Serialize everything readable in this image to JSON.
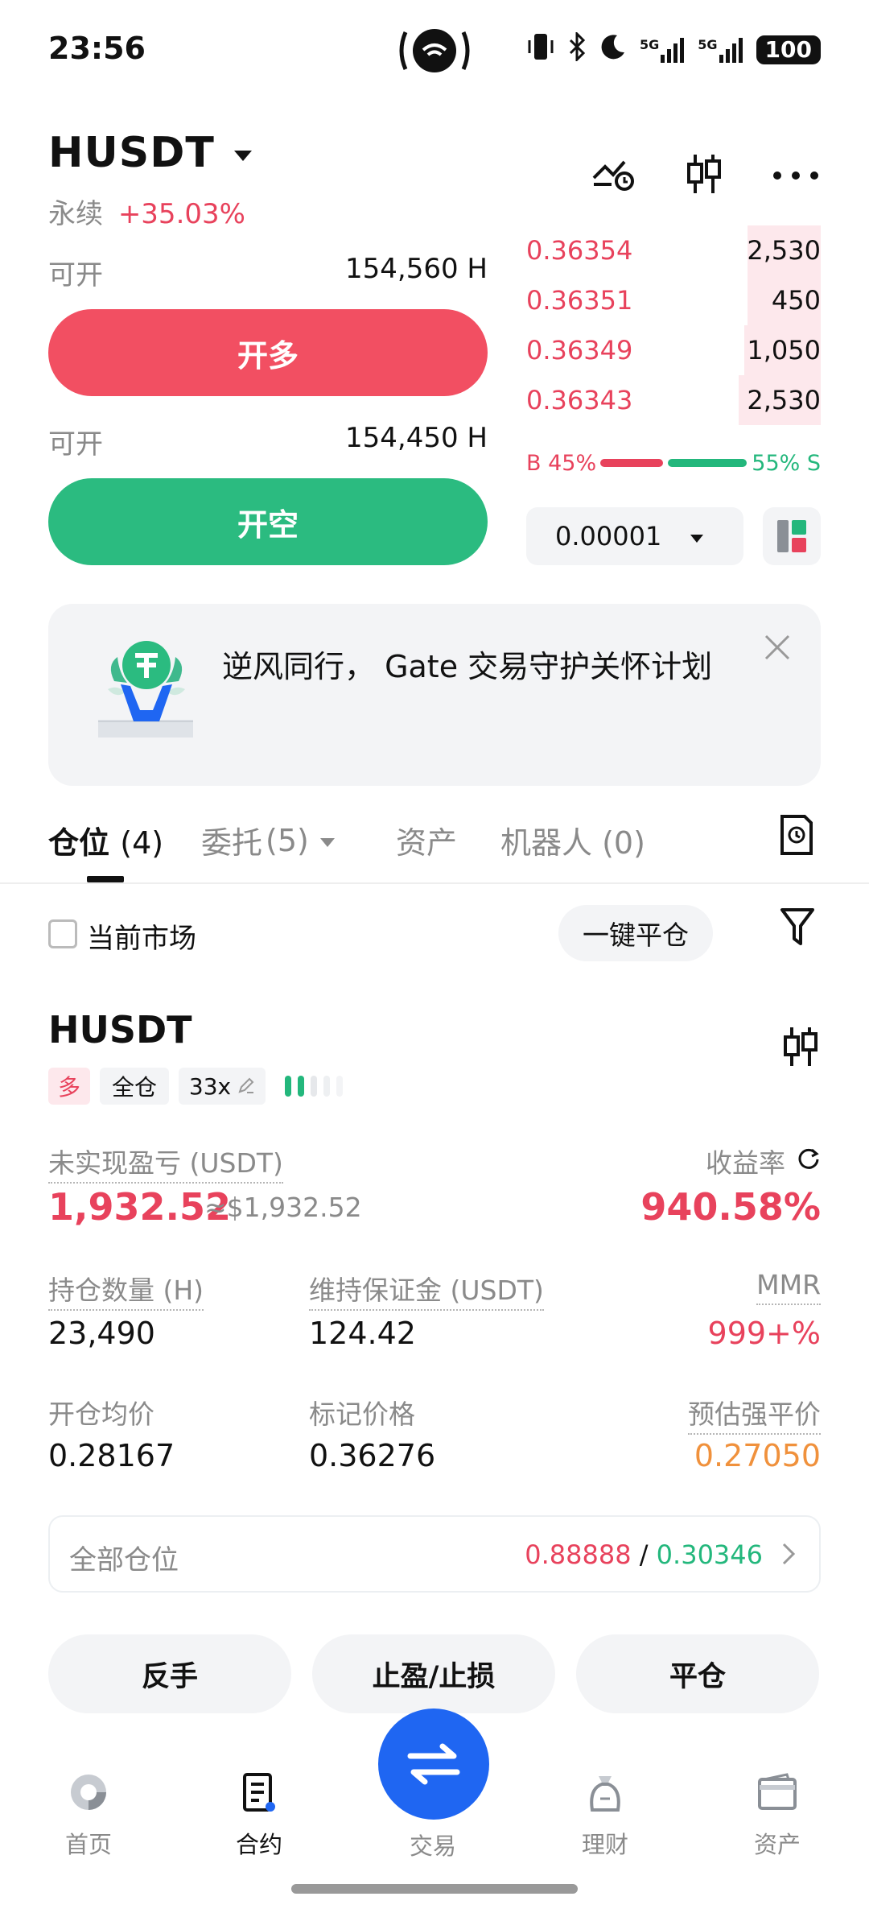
{
  "status": {
    "time": "23:56",
    "net1": "5G",
    "net2": "5G",
    "battery": "100"
  },
  "header": {
    "symbol": "HUSDT",
    "contract_type": "永续",
    "change": "+35.03%"
  },
  "order_panel": {
    "long_avail_label": "可开",
    "long_avail_value": "154,560 H",
    "long_button": "开多",
    "short_avail_label": "可开",
    "short_avail_value": "154,450 H",
    "short_button": "开空"
  },
  "orderbook": {
    "asks": [
      {
        "price": "0.36354",
        "qty": "2,530",
        "depth": 0.25
      },
      {
        "price": "0.36351",
        "qty": "450",
        "depth": 0.25
      },
      {
        "price": "0.36349",
        "qty": "1,050",
        "depth": 0.26
      },
      {
        "price": "0.36343",
        "qty": "2,530",
        "depth": 0.28
      }
    ],
    "buy_label": "B 45%",
    "sell_label": "55% S",
    "buy_ratio": 0.45,
    "precision": "0.00001"
  },
  "banner": {
    "text": "逆风同行， Gate 交易守护关怀计划"
  },
  "tabs": {
    "positions": "仓位",
    "positions_count": "(4)",
    "orders": "委托",
    "orders_count": "(5)",
    "assets": "资产",
    "bots": "机器人",
    "bots_count": "(0)"
  },
  "filter": {
    "current_market": "当前市场",
    "close_all": "一键平仓"
  },
  "position": {
    "symbol": "HUSDT",
    "side": "多",
    "margin_mode": "全仓",
    "leverage": "33x",
    "pnl_label": "未实现盈亏 (USDT)",
    "pnl_value": "1,932.52",
    "pnl_approx": "≈$1,932.52",
    "roe_label": "收益率",
    "roe_value": "940.58%",
    "size_label": "持仓数量 (H)",
    "size_value": "23,490",
    "maint_margin_label": "维持保证金 (USDT)",
    "maint_margin_value": "124.42",
    "mmr_label": "MMR",
    "mmr_value": "999+%",
    "entry_label": "开仓均价",
    "entry_value": "0.28167",
    "mark_label": "标记价格",
    "mark_value": "0.36276",
    "liq_label": "预估强平价",
    "liq_value": "0.27050",
    "all_positions_label": "全部仓位",
    "all_positions_red": "0.88888",
    "all_positions_sep": " / ",
    "all_positions_green": "0.30346",
    "btn_reverse": "反手",
    "btn_tpsl": "止盈/止损",
    "btn_close": "平仓"
  },
  "nav": {
    "home": "首页",
    "contract": "合约",
    "trade": "交易",
    "finance": "理财",
    "assets": "资产"
  },
  "colors": {
    "red": "#e8425c",
    "green": "#23b77c",
    "blue": "#1f66f2",
    "orange": "#f0913c"
  }
}
